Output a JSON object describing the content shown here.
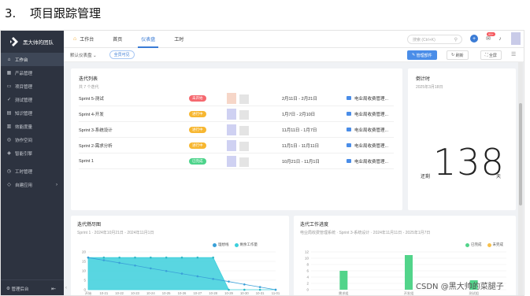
{
  "doc": {
    "number": "3.",
    "title": "项目跟踪管理"
  },
  "sidebar": {
    "brand": "黑大帅的团队",
    "items": [
      {
        "label": "工作台",
        "icon": "home-icon",
        "active": true
      },
      {
        "label": "产品管理",
        "icon": "grid-icon"
      },
      {
        "label": "项目管理",
        "icon": "folder-icon"
      },
      {
        "label": "测试管理",
        "icon": "test-icon"
      },
      {
        "label": "知识管理",
        "icon": "book-icon"
      },
      {
        "label": "效能度量",
        "icon": "chart-icon"
      },
      {
        "label": "协作空间",
        "icon": "team-icon"
      },
      {
        "label": "智能引擎",
        "icon": "engine-icon"
      },
      {
        "label": "工时管理",
        "icon": "clock-icon"
      },
      {
        "label": "自建应用",
        "icon": "app-icon"
      }
    ],
    "footer": "管理后台"
  },
  "topbar": {
    "tabs": [
      "工作台",
      "首页",
      "仪表盘",
      "工时"
    ],
    "active_tab": 2,
    "search_placeholder": "搜索 (Ctrl+K)",
    "badge": "99+"
  },
  "toolbar": {
    "view_select": "默认仪表盘",
    "view_tag": "全员可见",
    "manage_button": "管理部件",
    "refresh_button": "刷新",
    "fullscreen_button": "全屏"
  },
  "iteration_list": {
    "title": "迭代列表",
    "subtitle": "共 7 个迭代",
    "rows": [
      {
        "name": "Sprint 5-测试",
        "status": "未开始",
        "status_color": "#f5686f",
        "owner_color": "#f6d6c8",
        "dates": "2月11日 - 2月21日",
        "project": "电业局收费管理..."
      },
      {
        "name": "Sprint 4-开发",
        "status": "进行中",
        "status_color": "#f7b731",
        "owner_color": "#cfd1f2",
        "dates": "1月7日 - 2月10日",
        "project": "电业局收费管理..."
      },
      {
        "name": "Sprint 3-系统设计",
        "status": "进行中",
        "status_color": "#f7b731",
        "owner_color": "#cfd1f2",
        "dates": "11月11日 - 1月7日",
        "project": "电业局收费管理..."
      },
      {
        "name": "Sprint 2-需求分析",
        "status": "进行中",
        "status_color": "#f7b731",
        "owner_color": "#cfd1f2",
        "dates": "11月1日 - 11月11日",
        "project": "电业局收费管理..."
      },
      {
        "name": "Sprint 1",
        "status": "已完成",
        "status_color": "#4cd38a",
        "owner_color": "#cfd1f2",
        "dates": "10月21日 - 11月1日",
        "project": "电业局收费管理..."
      }
    ]
  },
  "countdown": {
    "title": "倒计时",
    "subtitle": "2025年3月18日",
    "prefix": "还剩",
    "value": "138",
    "unit": "天"
  },
  "burndown": {
    "title": "迭代燃尽图",
    "subtitle": "Sprint 1 · 2024年10月21日 - 2024年11月1日",
    "legend": [
      "理想线",
      "剩余工作量"
    ]
  },
  "progress": {
    "title": "迭代工作进度",
    "subtitle": "电业局收费管理系统 · Sprint 3-系统设计 · 2024年11月11日 - 2025年1月7日",
    "legend": [
      "已完成",
      "未完成"
    ]
  },
  "watermark": "CSDN @黑大帅的菜腿子",
  "chart_data": [
    {
      "type": "area",
      "title": "迭代燃尽图",
      "categories": [
        "开始",
        "10-21",
        "10-22",
        "10-23",
        "10-24",
        "10-25",
        "10-26",
        "10-27",
        "10-28",
        "10-29",
        "10-30",
        "10-31",
        "11-01"
      ],
      "series": [
        {
          "name": "理想线",
          "color": "#3aa0d8",
          "values": [
            17,
            15.6,
            14.2,
            12.8,
            11.3,
            9.9,
            8.5,
            7.1,
            5.7,
            4.3,
            2.8,
            1.4,
            0
          ]
        },
        {
          "name": "剩余工作量",
          "color": "#3ccfdc",
          "values": [
            17,
            17,
            17,
            17,
            17,
            17,
            17,
            17,
            17,
            0,
            0,
            0,
            0
          ]
        }
      ],
      "ylim": [
        0,
        20
      ],
      "yticks": [
        0,
        5,
        10,
        15,
        20
      ]
    },
    {
      "type": "bar",
      "title": "迭代工作进度",
      "categories": [
        "需求组",
        "开发组",
        "测试组"
      ],
      "series": [
        {
          "name": "已完成",
          "color": "#52d48a",
          "values": [
            6,
            11,
            3
          ]
        },
        {
          "name": "未完成",
          "color": "#f7c04a",
          "values": [
            0,
            0,
            0
          ]
        }
      ],
      "ylim": [
        0,
        12
      ],
      "yticks": [
        0,
        2,
        4,
        6,
        8,
        10,
        12
      ]
    }
  ]
}
